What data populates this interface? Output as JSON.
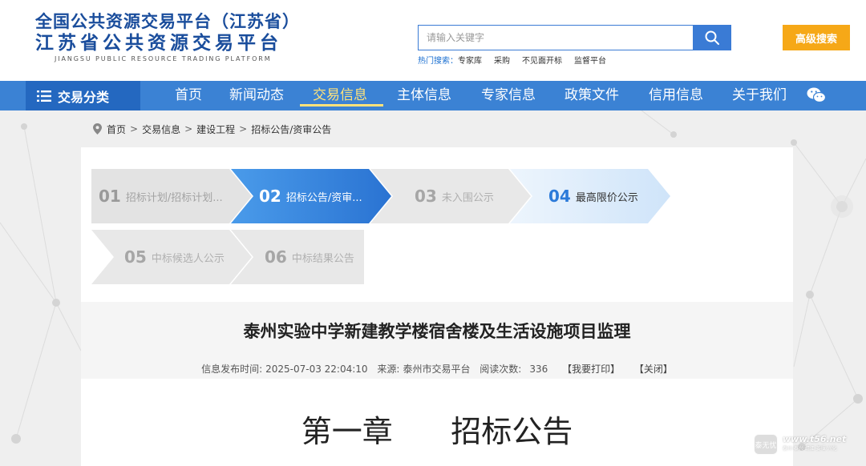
{
  "header": {
    "logo_line1": "全国公共资源交易平台（江苏省）",
    "logo_line2": "江苏省公共资源交易平台",
    "logo_line3": "JIANGSU PUBLIC RESOURCE TRADING PLATFORM",
    "search_placeholder": "请输入关键字",
    "hot_label": "热门搜索：",
    "hot_keywords": [
      "专家库",
      "采购",
      "不见面开标",
      "监督平台"
    ],
    "advanced_search": "高级搜索"
  },
  "nav": {
    "category_label": "交易分类",
    "items": [
      "首页",
      "新闻动态",
      "交易信息",
      "主体信息",
      "专家信息",
      "政策文件",
      "信用信息",
      "关于我们"
    ],
    "active_index": 2
  },
  "breadcrumb": [
    "首页",
    "交易信息",
    "建设工程",
    "招标公告/资审公告"
  ],
  "steps": [
    {
      "num": "01",
      "label": "招标计划/招标计划...",
      "state": "done"
    },
    {
      "num": "02",
      "label": "招标公告/资审...",
      "state": "current"
    },
    {
      "num": "03",
      "label": "未入围公示",
      "state": "inactive"
    },
    {
      "num": "04",
      "label": "最高限价公示",
      "state": "available"
    },
    {
      "num": "05",
      "label": "中标候选人公示",
      "state": "inactive"
    },
    {
      "num": "06",
      "label": "中标结果公告",
      "state": "inactive"
    }
  ],
  "article": {
    "title": "泰州实验中学新建教学楼宿舍楼及生活设施项目监理",
    "publish_label": "信息发布时间:",
    "publish_time": "2025-07-03 22:04:10",
    "source_label": "来源:",
    "source": "泰州市交易平台",
    "reads_label": "阅读次数:",
    "reads": "336",
    "print_label": "【我要打印】",
    "close_label": "【关闭】",
    "chapter_heading": "第一章      招标公告"
  },
  "watermark": {
    "logo_text": "泰无忧",
    "site": "www.t56.net",
    "sub": "泰州·泰兴·靖江·姜堰·兴化"
  },
  "colors": {
    "brand_blue": "#1a4d9c",
    "nav_blue": "#3b82d4",
    "nav_dark": "#2468c0",
    "active_yellow": "#ffe27a",
    "adv_orange": "#f6a817",
    "step_current": "#2b7ad9",
    "step_available": "#d9ebfb"
  }
}
